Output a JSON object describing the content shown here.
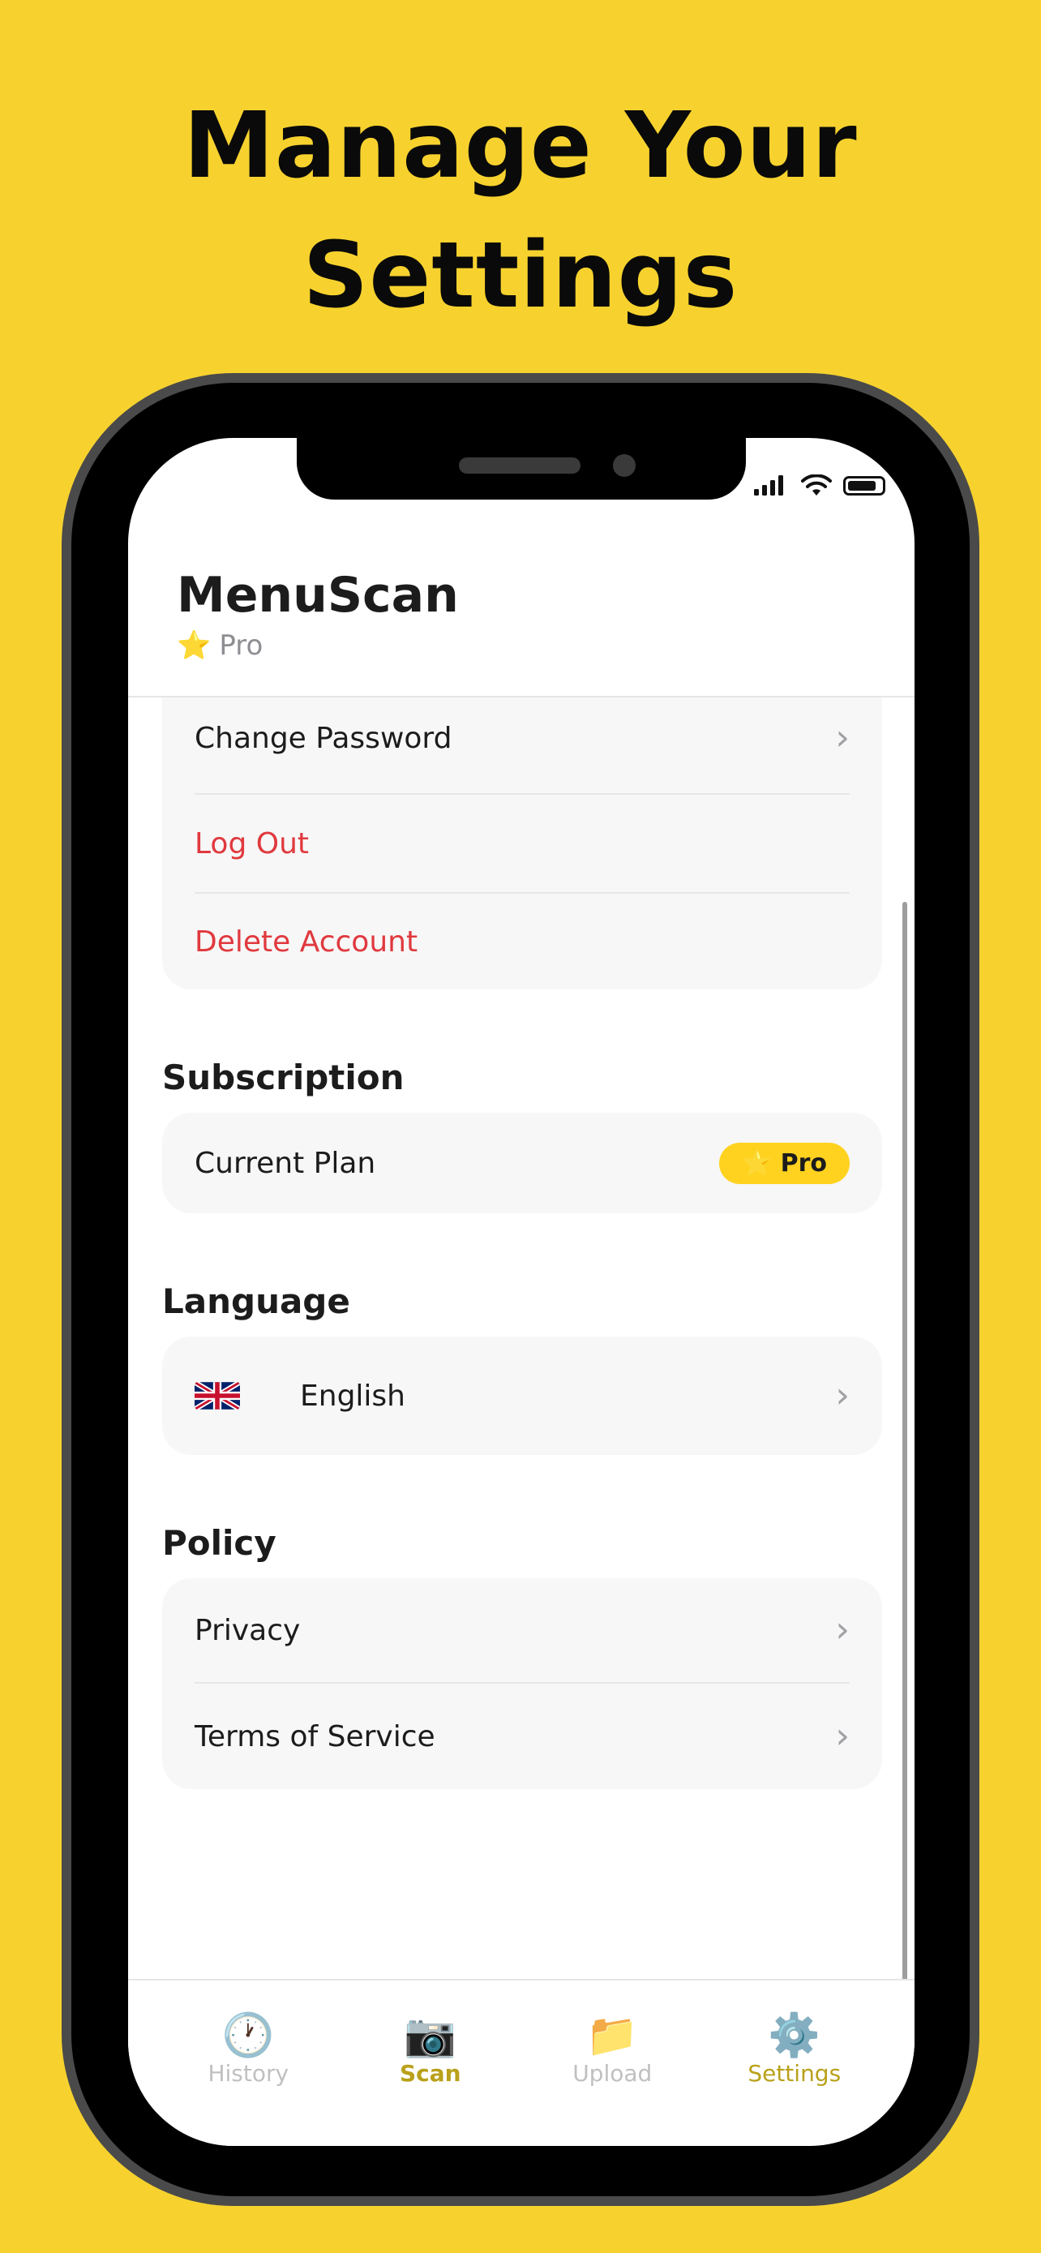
{
  "headline": {
    "line1": "Manage Your",
    "line2": "Settings"
  },
  "app": {
    "title": "MenuScan",
    "plan_label": "Pro"
  },
  "account": {
    "change_password": "Change Password",
    "log_out": "Log Out",
    "delete_account": "Delete Account"
  },
  "subscription": {
    "section_title": "Subscription",
    "current_plan_label": "Current Plan",
    "badge_label": "Pro"
  },
  "language": {
    "section_title": "Language",
    "value": "English"
  },
  "policy": {
    "section_title": "Policy",
    "privacy": "Privacy",
    "terms": "Terms of Service"
  },
  "tabs": [
    {
      "label": "History",
      "icon": "clock-icon"
    },
    {
      "label": "Scan",
      "icon": "camera-icon"
    },
    {
      "label": "Upload",
      "icon": "folder-icon"
    },
    {
      "label": "Settings",
      "icon": "gear-icon"
    }
  ],
  "colors": {
    "background": "#F7D22E",
    "accent": "#FFD21F",
    "danger": "#E0393E",
    "tab_active": "#B9A11B"
  }
}
